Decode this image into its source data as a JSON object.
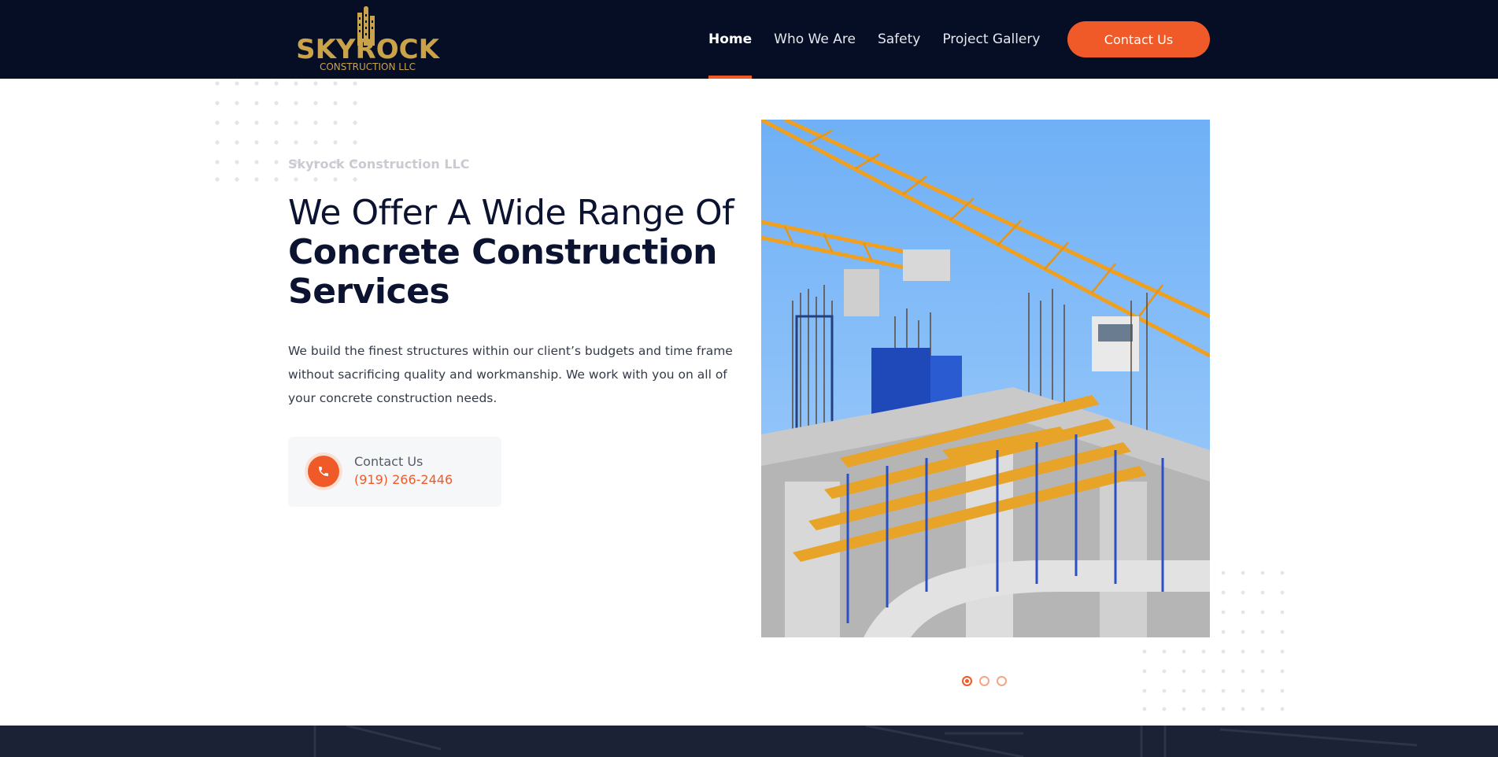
{
  "header": {
    "logo": {
      "top": "SKYROCK",
      "bottom": "CONSTRUCTION LLC"
    },
    "nav": [
      "Home",
      "Who We Are",
      "Safety",
      "Project Gallery"
    ],
    "active_nav": "Home",
    "cta_label": "Contact Us"
  },
  "hero": {
    "eyebrow": "Skyrock Construction LLC",
    "headline_light": "We Offer A Wide Range Of",
    "headline_bold_1": "Concrete Construction",
    "headline_bold_2": "Services",
    "description": "We build the finest structures within our client’s budgets and time frame without sacrificing quality and workmanship. We work with you on all of your concrete construction needs.",
    "contact": {
      "label": "Contact Us",
      "phone": "(919) 266-2446"
    },
    "slider": {
      "count": 3,
      "active": 0
    }
  },
  "colors": {
    "header_bg": "#060e26",
    "accent": "#f05a28",
    "logo_gold": "#c9a24a",
    "heading": "#0b1330"
  }
}
